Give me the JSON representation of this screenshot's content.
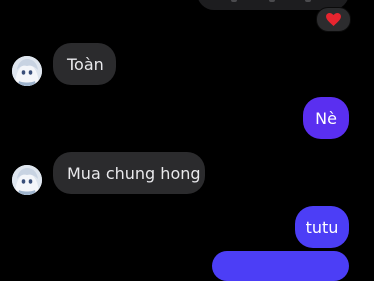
{
  "colors": {
    "background": "#000000",
    "incoming_bubble": "#2b2b2d",
    "outgoing_bubble": "#5a2ff0",
    "reaction_heart": "#e8252f"
  },
  "top": {
    "reaction_icon": "heart-icon"
  },
  "messages": [
    {
      "direction": "incoming",
      "text": "Toàn",
      "avatar_icon": "avatar-icon"
    },
    {
      "direction": "outgoing",
      "text": "Nè"
    },
    {
      "direction": "incoming",
      "text": "Mua chung hong",
      "avatar_icon": "avatar-icon"
    },
    {
      "direction": "outgoing",
      "text": "tutu"
    }
  ]
}
